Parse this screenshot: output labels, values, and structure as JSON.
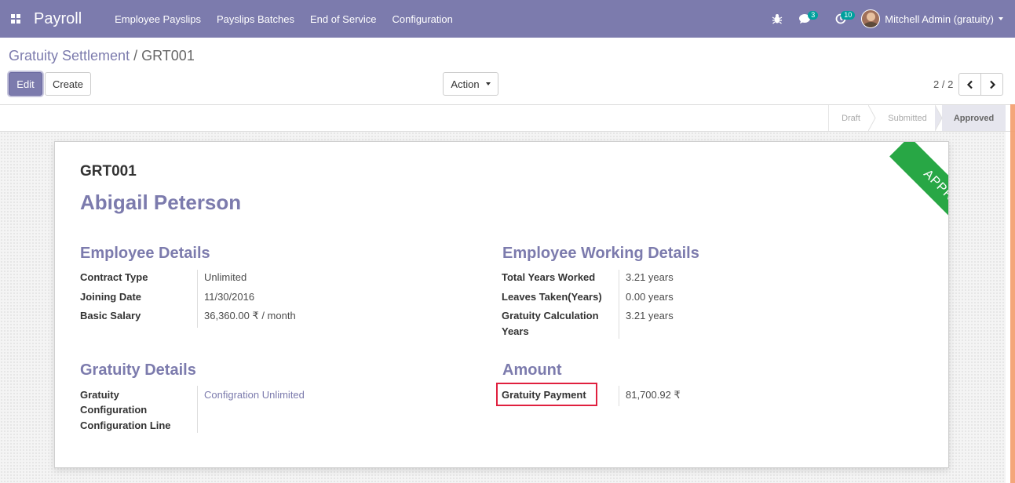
{
  "navbar": {
    "app_name": "Payroll",
    "menu": [
      "Employee Payslips",
      "Payslips Batches",
      "End of Service",
      "Configuration"
    ],
    "messages_count": "3",
    "activities_count": "10",
    "user_name": "Mitchell Admin (gratuity)",
    "color": "#7c7bad"
  },
  "breadcrumb": {
    "parent": "Gratuity Settlement",
    "separator": "/",
    "current": "GRT001"
  },
  "toolbar": {
    "edit_label": "Edit",
    "create_label": "Create",
    "action_label": "Action"
  },
  "pager": {
    "value": "2 / 2"
  },
  "statusbar": {
    "stages": [
      "Draft",
      "Submitted",
      "Approved"
    ],
    "active": "Approved"
  },
  "record": {
    "ribbon": "APPROVED",
    "reference": "GRT001",
    "employee_name": "Abigail Peterson"
  },
  "employee_details": {
    "title": "Employee Details",
    "contract_type_label": "Contract Type",
    "contract_type": "Unlimited",
    "joining_date_label": "Joining Date",
    "joining_date": "11/30/2016",
    "basic_salary_label": "Basic Salary",
    "basic_salary": "36,360.00 ₹  / month"
  },
  "working_details": {
    "title": "Employee Working Details",
    "total_years_label": "Total Years Worked",
    "total_years": "3.21 years",
    "leaves_label": "Leaves Taken(Years)",
    "leaves": "0.00 years",
    "calc_years_label_1": "Gratuity Calculation",
    "calc_years_label_2": "Years",
    "calc_years": "3.21 years"
  },
  "gratuity_details": {
    "title": "Gratuity Details",
    "config_label_1": "Gratuity",
    "config_label_2": "Configuration",
    "config_line_label": "Configuration Line",
    "config_value": "Configration Unlimited"
  },
  "amount": {
    "title": "Amount",
    "payment_label": "Gratuity Payment",
    "payment_value": "81,700.92 ₹"
  }
}
